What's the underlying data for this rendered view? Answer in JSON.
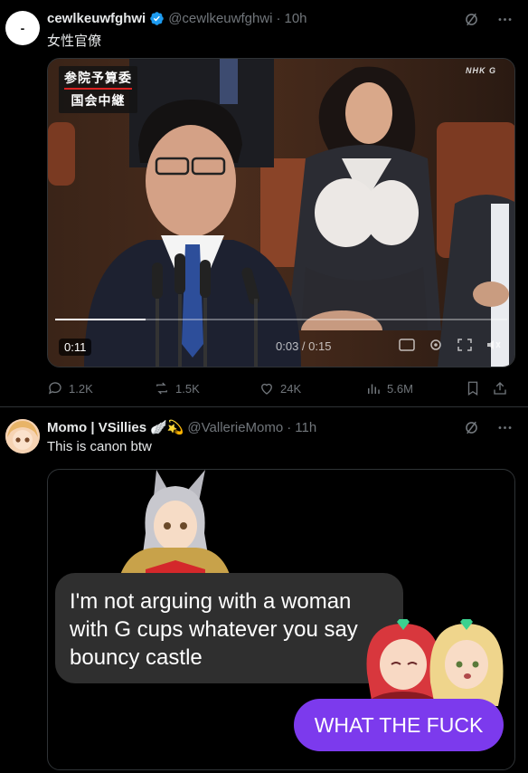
{
  "post1": {
    "avatar_text": "-",
    "name": "cewlkeuwfghwi",
    "handle": "@cewlkeuwfghwi",
    "dot": "·",
    "time": "10h",
    "text": "女性官僚",
    "video": {
      "caption_line1": "参院予算委",
      "caption_line2": "国会中継",
      "logo": "NHK G",
      "elapsed": "0:11",
      "timecode": "0:03 / 0:15",
      "progress": 0.2
    },
    "actions": {
      "replies": "1.2K",
      "reposts": "1.5K",
      "likes": "24K",
      "views": "5.6M"
    }
  },
  "post2": {
    "name": "Momo | VSillies",
    "emoji": "🪽💫",
    "handle": "@VallerieMomo",
    "dot": "·",
    "time": "11h",
    "text": "This is canon btw",
    "meme": {
      "bubble_text": "I'm not arguing with a woman with G cups whatever you say bouncy castle",
      "reply_text": "WHAT THE FUCK",
      "reply_color": "#7c3aed"
    }
  },
  "colors": {
    "background": "#000000",
    "text": "#e7e9ea",
    "muted": "#71767b",
    "border": "#2f3336",
    "verified": "#1d9bf0"
  }
}
